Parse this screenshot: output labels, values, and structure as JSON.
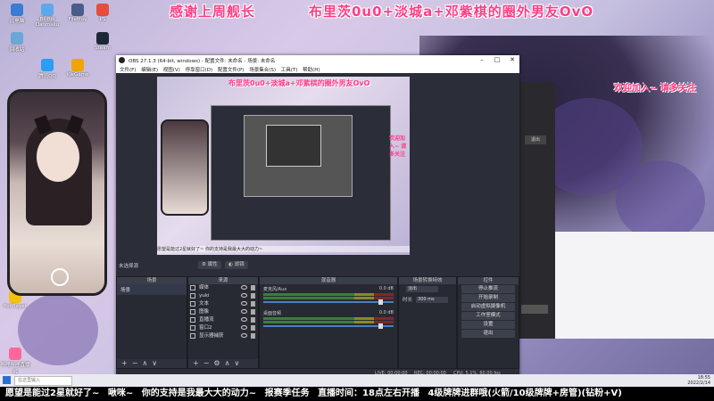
{
  "overlay": {
    "top_marquee_a": "感谢上周舰长",
    "top_marquee_b": "布里茨0u0+淡城a+邓紫棋的圈外男友OvO",
    "side_note": "欢迎加入~ 请多关注",
    "bottom_ticker": [
      "愿望是能过2星就好了~",
      "啾咪~",
      "你的支持是我最大大的动力~",
      "报赛季任务",
      "直播时间：18点左右开播",
      "4级牌牌进群哦(火箭/10级牌牌+房管)(钻粉+V)"
    ]
  },
  "desktop_icons": [
    {
      "label": "此电脑",
      "color": "#3a7bd5"
    },
    {
      "label": "BiliBili Danmaku",
      "color": "#5fa8e8"
    },
    {
      "label": "FileMov",
      "color": "#4a5c8a"
    },
    {
      "label": "PS",
      "color": "#e84c3d"
    },
    {
      "label": "回收站",
      "color": "#6aa6d6"
    },
    {
      "label": "Steam",
      "color": "#1b2838"
    },
    {
      "label": "腾讯QQ",
      "color": "#2a9df4"
    },
    {
      "label": "WeGame",
      "color": "#f2a400"
    },
    {
      "label": "PotPlayer",
      "color": "#f4c20d"
    },
    {
      "label": "哔哩哔哩直播姬",
      "color": "#ff6699"
    }
  ],
  "obs": {
    "title": "OBS 27.1.3 (64-bit, windows) - 配置文件: 未命名 - 场景: 未命名",
    "menu": [
      "文件(F)",
      "编辑(E)",
      "视图(V)",
      "停靠窗口(D)",
      "配置文件(P)",
      "场景集合(S)",
      "工具(T)",
      "帮助(H)"
    ],
    "no_source": "未选择源",
    "props_btn": "属性",
    "filters_btn": "滤镜",
    "docks": {
      "scenes": "场景",
      "sources": "来源",
      "mixer": "混音器",
      "transitions": "场景转换特效",
      "controls": "控件"
    },
    "scenes": [
      "场景"
    ],
    "sources": [
      "媒体",
      "yuki",
      "文本",
      "图像",
      "直播流",
      "窗口2",
      "显示器捕获"
    ],
    "mixer": [
      {
        "name": "麦克风/Aux",
        "db": "0.0 dB"
      },
      {
        "name": "桌面音频",
        "db": "0.0 dB"
      }
    ],
    "transition": {
      "type": "淡出",
      "label": "时长",
      "duration": "300 ms"
    },
    "controls": [
      "停止推流",
      "开始录制",
      "启动虚拟摄像机",
      "工作室模式",
      "设置",
      "退出"
    ],
    "status": {
      "live": "LIVE: 00:00:00",
      "rec": "REC: 00:00:00",
      "cpu": "CPU: 5.1%, 60.00 fps"
    }
  },
  "taskbar": {
    "search": "在这里输入",
    "time": "18:55",
    "date": "2022/2/14"
  }
}
